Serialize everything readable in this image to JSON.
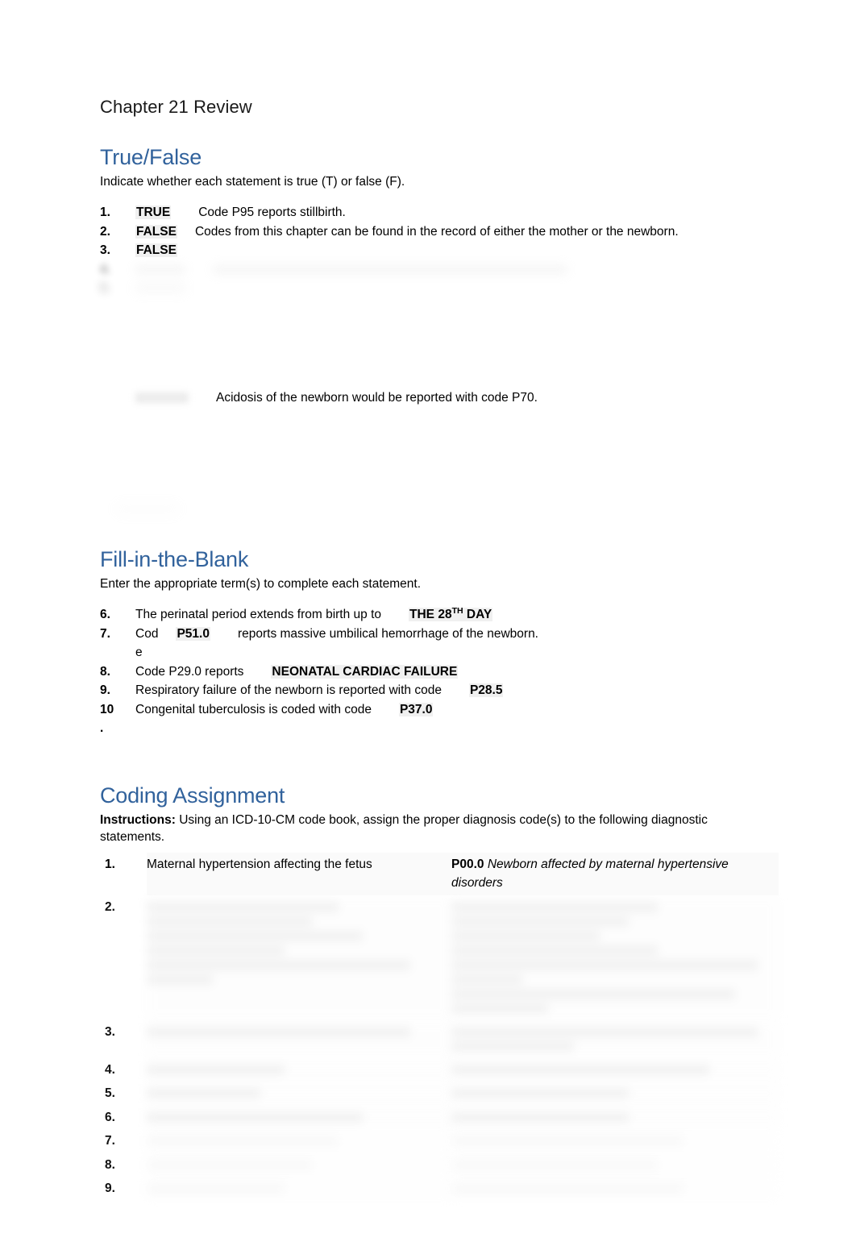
{
  "document": {
    "title": "Chapter 21 Review"
  },
  "sections": {
    "true_false": {
      "heading": "True/False",
      "instructions": "Indicate whether each statement is true (T) or false (F).",
      "items": [
        {
          "num": "1.",
          "answer": "TRUE",
          "statement": "Code P95 reports stillbirth.",
          "redacted": false
        },
        {
          "num": "2.",
          "answer": "FALSE",
          "statement": "Codes from this chapter can be found in the record of either the mother or the newborn.",
          "redacted": false
        },
        {
          "num": "3.",
          "answer": "FALSE",
          "statement": "",
          "redacted": false
        },
        {
          "num": "4.",
          "answer": "",
          "statement": "",
          "redacted": true
        },
        {
          "num": "5.",
          "answer": "",
          "statement": "",
          "redacted": true
        }
      ],
      "visible_fragment": {
        "answer": "",
        "statement": "Acidosis of the newborn would be reported with code P70."
      }
    },
    "fill_in_the_blank": {
      "heading": "Fill-in-the-Blank",
      "instructions": "Enter the appropriate term(s) to complete each statement.",
      "items": [
        {
          "num": "6.",
          "before": "The perinatal period extends from birth up to",
          "answer": "THE 28",
          "answer_sup": "TH",
          "answer_tail": " DAY",
          "after": ""
        },
        {
          "num": "7.",
          "before": "Cod",
          "answer": "P51.0",
          "after": "reports massive umbilical hemorrhage of the newborn.",
          "wrapped": "e"
        },
        {
          "num": "8.",
          "before": "Code P29.0 reports",
          "answer": "NEONATAL CARDIAC FAILURE",
          "after": ""
        },
        {
          "num": "9.",
          "before": "Respiratory failure of the newborn is reported with code",
          "answer": "P28.5",
          "after": ""
        },
        {
          "num": "10",
          "num_wrapped": ".",
          "before": "Congenital tuberculosis is coded with code",
          "answer": "P37.0",
          "after": ""
        }
      ]
    },
    "coding_assignment": {
      "heading": "Coding Assignment",
      "instructions_label": "Instructions:",
      "instructions_text": "Using an ICD-10-CM code book, assign the proper diagnosis code(s) to the following diagnostic statements.",
      "rows": [
        {
          "num": "1.",
          "statement": "Maternal hypertension affecting the fetus",
          "code": "P00.0",
          "code_description": "Newborn affected by maternal hypertensive disorders",
          "redacted": false
        },
        {
          "num": "2.",
          "statement": "",
          "code": "",
          "code_description": "",
          "redacted": true
        },
        {
          "num": "3.",
          "statement": "",
          "code": "",
          "code_description": "",
          "redacted": true
        },
        {
          "num": "4.",
          "statement": "",
          "code": "",
          "code_description": "",
          "redacted": true
        },
        {
          "num": "5.",
          "statement": "",
          "code": "",
          "code_description": "",
          "redacted": true
        },
        {
          "num": "6.",
          "statement": "",
          "code": "",
          "code_description": "",
          "redacted": true
        },
        {
          "num": "7.",
          "statement": "",
          "code": "",
          "code_description": "",
          "redacted": true
        },
        {
          "num": "8.",
          "statement": "",
          "code": "",
          "code_description": "",
          "redacted": true
        },
        {
          "num": "9.",
          "statement": "",
          "code": "",
          "code_description": "",
          "redacted": true
        }
      ]
    }
  },
  "colors": {
    "heading_blue": "#31629C",
    "body_text": "#000000",
    "highlight": "#f0f0f0",
    "table_cell": "#fafafa"
  }
}
